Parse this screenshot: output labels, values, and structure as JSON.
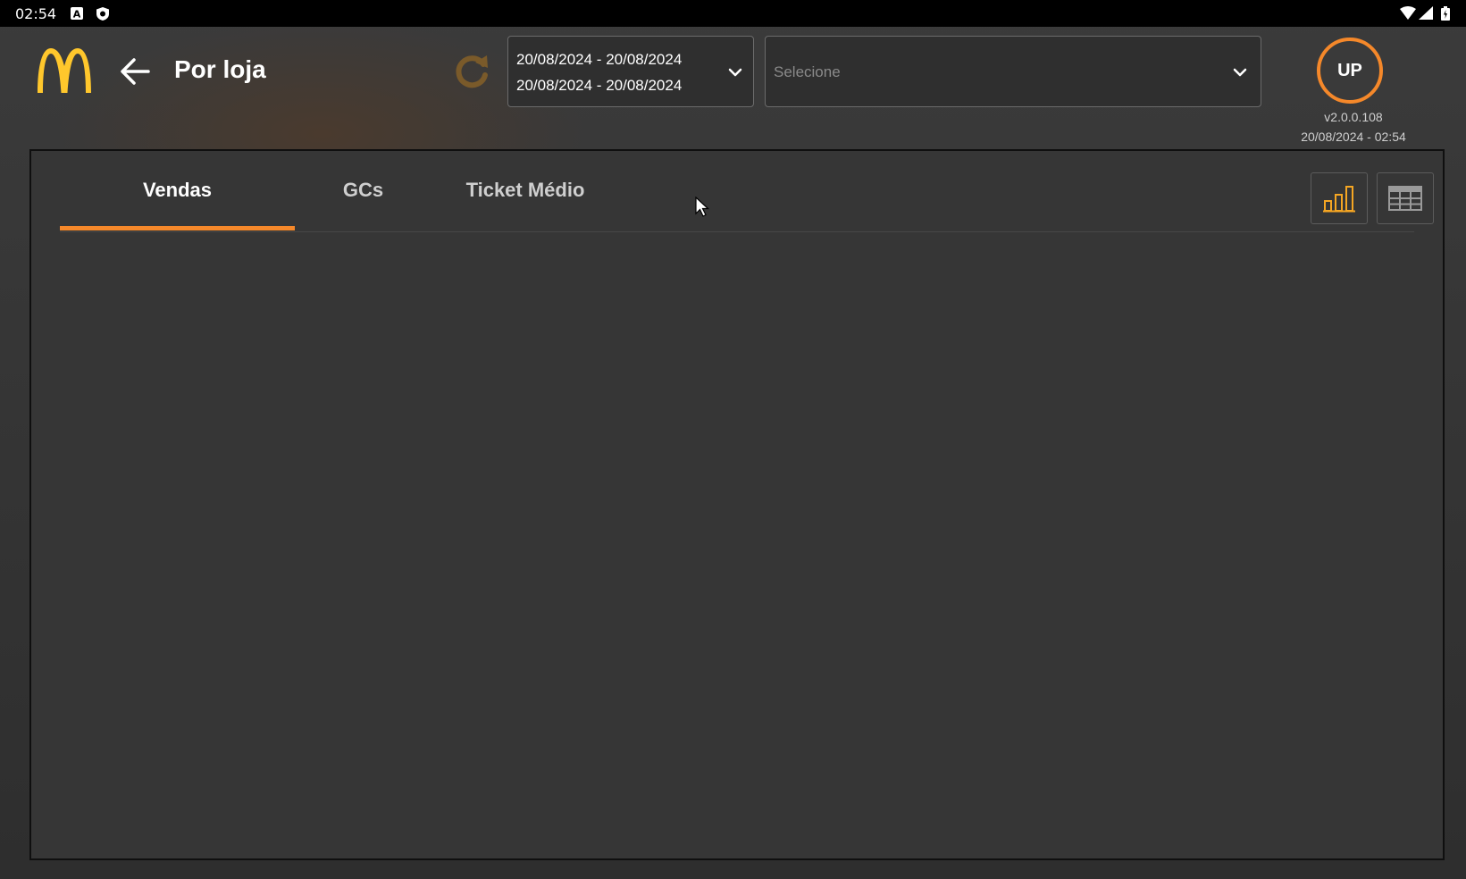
{
  "status_bar": {
    "time": "02:54",
    "left_icons": [
      "a-notification-icon",
      "shield-notification-icon"
    ],
    "right_icons": [
      "wifi-icon",
      "cell-signal-icon",
      "battery-icon"
    ]
  },
  "header": {
    "logo": "mcdonalds-arches-logo",
    "title": "Por loja",
    "date_range": {
      "line1": "20/08/2024 - 20/08/2024",
      "line2": "20/08/2024 - 20/08/2024"
    },
    "store_select": {
      "placeholder": "Selecione"
    },
    "avatar_initials": "UP",
    "version": "v2.0.0.108",
    "timestamp": "20/08/2024 - 02:54"
  },
  "tabs": [
    {
      "label": "Vendas",
      "active": true
    },
    {
      "label": "GCs",
      "active": false
    },
    {
      "label": "Ticket Médio",
      "active": false
    }
  ],
  "view_toggle": {
    "chart_view_active": true,
    "icons": [
      "bar-chart-icon",
      "table-icon"
    ]
  },
  "colors": {
    "accent": "#f5882a",
    "logo": "#ffc72c",
    "panel": "#363636"
  }
}
